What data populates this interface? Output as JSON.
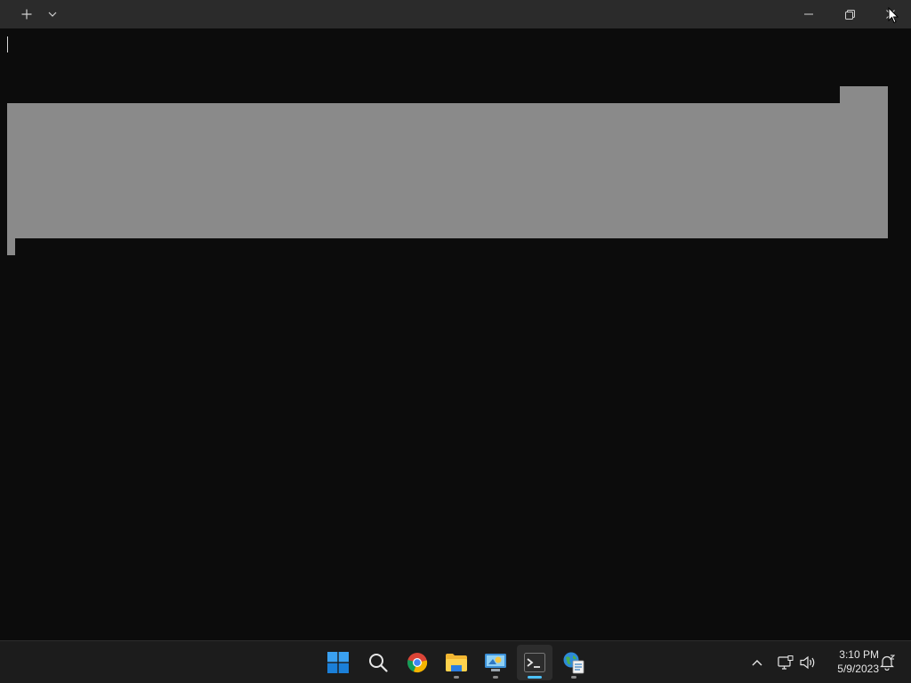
{
  "window": {
    "app": "Windows Terminal",
    "controls": [
      "new-tab",
      "tab-dropdown",
      "minimize",
      "maximize",
      "close"
    ]
  },
  "terminal": {
    "content": "",
    "background": "#0c0c0c",
    "selection_color": "#8a8a8a"
  },
  "taskbar": {
    "apps": [
      {
        "name": "start",
        "icon": "windows-start-icon"
      },
      {
        "name": "search",
        "icon": "search-icon"
      },
      {
        "name": "chrome",
        "icon": "chrome-icon"
      },
      {
        "name": "file-explorer",
        "icon": "folder-icon",
        "running": true
      },
      {
        "name": "control-panel",
        "icon": "control-panel-icon",
        "running": true
      },
      {
        "name": "terminal",
        "icon": "terminal-icon",
        "running": true,
        "active": true
      },
      {
        "name": "network-app",
        "icon": "globe-doc-icon",
        "running": true
      }
    ],
    "tray": {
      "time": "3:10 PM",
      "date": "5/9/2023",
      "icons": [
        "chevron-up-icon",
        "network-icon",
        "volume-icon",
        "notification-icon"
      ]
    },
    "accent": "#4cc2ff"
  }
}
